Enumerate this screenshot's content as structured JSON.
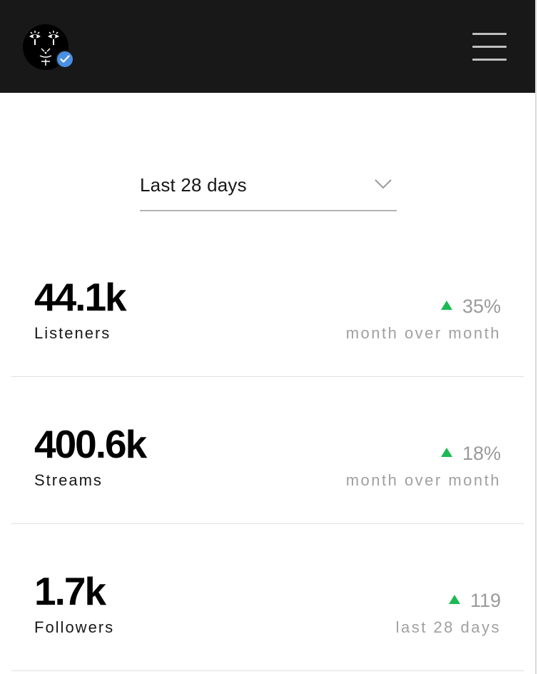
{
  "header": {
    "avatar_icon": "artist-avatar-icon",
    "verified_icon": "verified-check-icon",
    "menu_icon": "hamburger-menu-icon"
  },
  "range_select": {
    "selected": "Last 28 days",
    "icon": "chevron-down-icon"
  },
  "stats": [
    {
      "value": "44.1k",
      "label": "Listeners",
      "change": "35%",
      "change_direction": "up",
      "period": "month over month"
    },
    {
      "value": "400.6k",
      "label": "Streams",
      "change": "18%",
      "change_direction": "up",
      "period": "month over month"
    },
    {
      "value": "1.7k",
      "label": "Followers",
      "change": "119",
      "change_direction": "up",
      "period": "last 28 days"
    }
  ],
  "colors": {
    "topbar": "#181818",
    "accent_up": "#1db954",
    "verified": "#4a90e2",
    "muted_text": "#9a9a9a"
  }
}
